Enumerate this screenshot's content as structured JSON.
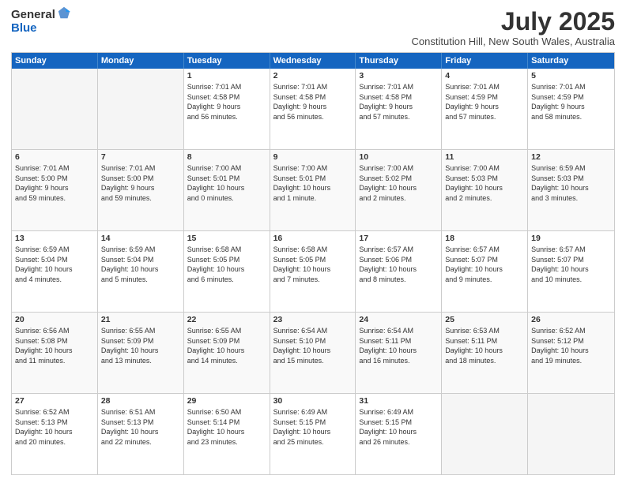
{
  "header": {
    "logo_general": "General",
    "logo_blue": "Blue",
    "title": "July 2025",
    "location": "Constitution Hill, New South Wales, Australia"
  },
  "days_of_week": [
    "Sunday",
    "Monday",
    "Tuesday",
    "Wednesday",
    "Thursday",
    "Friday",
    "Saturday"
  ],
  "weeks": [
    [
      {
        "day": "",
        "info": ""
      },
      {
        "day": "",
        "info": ""
      },
      {
        "day": "1",
        "info": "Sunrise: 7:01 AM\nSunset: 4:58 PM\nDaylight: 9 hours\nand 56 minutes."
      },
      {
        "day": "2",
        "info": "Sunrise: 7:01 AM\nSunset: 4:58 PM\nDaylight: 9 hours\nand 56 minutes."
      },
      {
        "day": "3",
        "info": "Sunrise: 7:01 AM\nSunset: 4:58 PM\nDaylight: 9 hours\nand 57 minutes."
      },
      {
        "day": "4",
        "info": "Sunrise: 7:01 AM\nSunset: 4:59 PM\nDaylight: 9 hours\nand 57 minutes."
      },
      {
        "day": "5",
        "info": "Sunrise: 7:01 AM\nSunset: 4:59 PM\nDaylight: 9 hours\nand 58 minutes."
      }
    ],
    [
      {
        "day": "6",
        "info": "Sunrise: 7:01 AM\nSunset: 5:00 PM\nDaylight: 9 hours\nand 59 minutes."
      },
      {
        "day": "7",
        "info": "Sunrise: 7:01 AM\nSunset: 5:00 PM\nDaylight: 9 hours\nand 59 minutes."
      },
      {
        "day": "8",
        "info": "Sunrise: 7:00 AM\nSunset: 5:01 PM\nDaylight: 10 hours\nand 0 minutes."
      },
      {
        "day": "9",
        "info": "Sunrise: 7:00 AM\nSunset: 5:01 PM\nDaylight: 10 hours\nand 1 minute."
      },
      {
        "day": "10",
        "info": "Sunrise: 7:00 AM\nSunset: 5:02 PM\nDaylight: 10 hours\nand 2 minutes."
      },
      {
        "day": "11",
        "info": "Sunrise: 7:00 AM\nSunset: 5:03 PM\nDaylight: 10 hours\nand 2 minutes."
      },
      {
        "day": "12",
        "info": "Sunrise: 6:59 AM\nSunset: 5:03 PM\nDaylight: 10 hours\nand 3 minutes."
      }
    ],
    [
      {
        "day": "13",
        "info": "Sunrise: 6:59 AM\nSunset: 5:04 PM\nDaylight: 10 hours\nand 4 minutes."
      },
      {
        "day": "14",
        "info": "Sunrise: 6:59 AM\nSunset: 5:04 PM\nDaylight: 10 hours\nand 5 minutes."
      },
      {
        "day": "15",
        "info": "Sunrise: 6:58 AM\nSunset: 5:05 PM\nDaylight: 10 hours\nand 6 minutes."
      },
      {
        "day": "16",
        "info": "Sunrise: 6:58 AM\nSunset: 5:05 PM\nDaylight: 10 hours\nand 7 minutes."
      },
      {
        "day": "17",
        "info": "Sunrise: 6:57 AM\nSunset: 5:06 PM\nDaylight: 10 hours\nand 8 minutes."
      },
      {
        "day": "18",
        "info": "Sunrise: 6:57 AM\nSunset: 5:07 PM\nDaylight: 10 hours\nand 9 minutes."
      },
      {
        "day": "19",
        "info": "Sunrise: 6:57 AM\nSunset: 5:07 PM\nDaylight: 10 hours\nand 10 minutes."
      }
    ],
    [
      {
        "day": "20",
        "info": "Sunrise: 6:56 AM\nSunset: 5:08 PM\nDaylight: 10 hours\nand 11 minutes."
      },
      {
        "day": "21",
        "info": "Sunrise: 6:55 AM\nSunset: 5:09 PM\nDaylight: 10 hours\nand 13 minutes."
      },
      {
        "day": "22",
        "info": "Sunrise: 6:55 AM\nSunset: 5:09 PM\nDaylight: 10 hours\nand 14 minutes."
      },
      {
        "day": "23",
        "info": "Sunrise: 6:54 AM\nSunset: 5:10 PM\nDaylight: 10 hours\nand 15 minutes."
      },
      {
        "day": "24",
        "info": "Sunrise: 6:54 AM\nSunset: 5:11 PM\nDaylight: 10 hours\nand 16 minutes."
      },
      {
        "day": "25",
        "info": "Sunrise: 6:53 AM\nSunset: 5:11 PM\nDaylight: 10 hours\nand 18 minutes."
      },
      {
        "day": "26",
        "info": "Sunrise: 6:52 AM\nSunset: 5:12 PM\nDaylight: 10 hours\nand 19 minutes."
      }
    ],
    [
      {
        "day": "27",
        "info": "Sunrise: 6:52 AM\nSunset: 5:13 PM\nDaylight: 10 hours\nand 20 minutes."
      },
      {
        "day": "28",
        "info": "Sunrise: 6:51 AM\nSunset: 5:13 PM\nDaylight: 10 hours\nand 22 minutes."
      },
      {
        "day": "29",
        "info": "Sunrise: 6:50 AM\nSunset: 5:14 PM\nDaylight: 10 hours\nand 23 minutes."
      },
      {
        "day": "30",
        "info": "Sunrise: 6:49 AM\nSunset: 5:15 PM\nDaylight: 10 hours\nand 25 minutes."
      },
      {
        "day": "31",
        "info": "Sunrise: 6:49 AM\nSunset: 5:15 PM\nDaylight: 10 hours\nand 26 minutes."
      },
      {
        "day": "",
        "info": ""
      },
      {
        "day": "",
        "info": ""
      }
    ]
  ]
}
